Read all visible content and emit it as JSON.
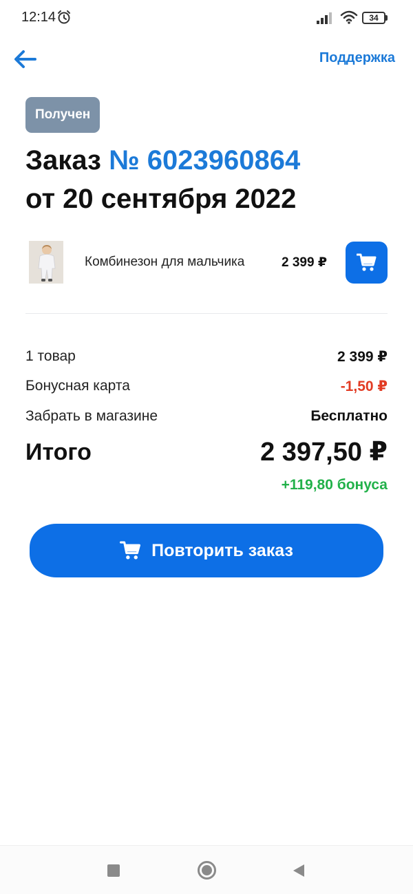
{
  "status_bar": {
    "time": "12:14",
    "battery": "34"
  },
  "header": {
    "support_label": "Поддержка"
  },
  "order": {
    "status": "Получен",
    "title_prefix": "Заказ",
    "number": "№ 6023960864",
    "date": "от 20 сентября 2022"
  },
  "product": {
    "name": "Комбинезон для мальчика",
    "price": "2 399 ₽"
  },
  "summary": {
    "items_label": "1 товар",
    "items_value": "2 399 ₽",
    "bonus_card_label": "Бонусная карта",
    "bonus_card_value": "-1,50 ₽",
    "pickup_label": "Забрать в магазине",
    "pickup_value": "Бесплатно",
    "total_label": "Итого",
    "total_value": "2 397,50 ₽",
    "bonus_earned": "+119,80 бонуса"
  },
  "actions": {
    "repeat_order": "Повторить заказ"
  },
  "colors": {
    "accent": "#0d6fe6",
    "link": "#1c7ad8",
    "badge": "#7d92a8",
    "discount": "#e23b23",
    "bonus": "#22b14a"
  },
  "icons": [
    "alarm-icon",
    "signal-icon",
    "wifi-icon",
    "battery-icon",
    "back-arrow-icon",
    "cart-icon",
    "nav-recents-icon",
    "nav-home-icon",
    "nav-back-icon"
  ]
}
